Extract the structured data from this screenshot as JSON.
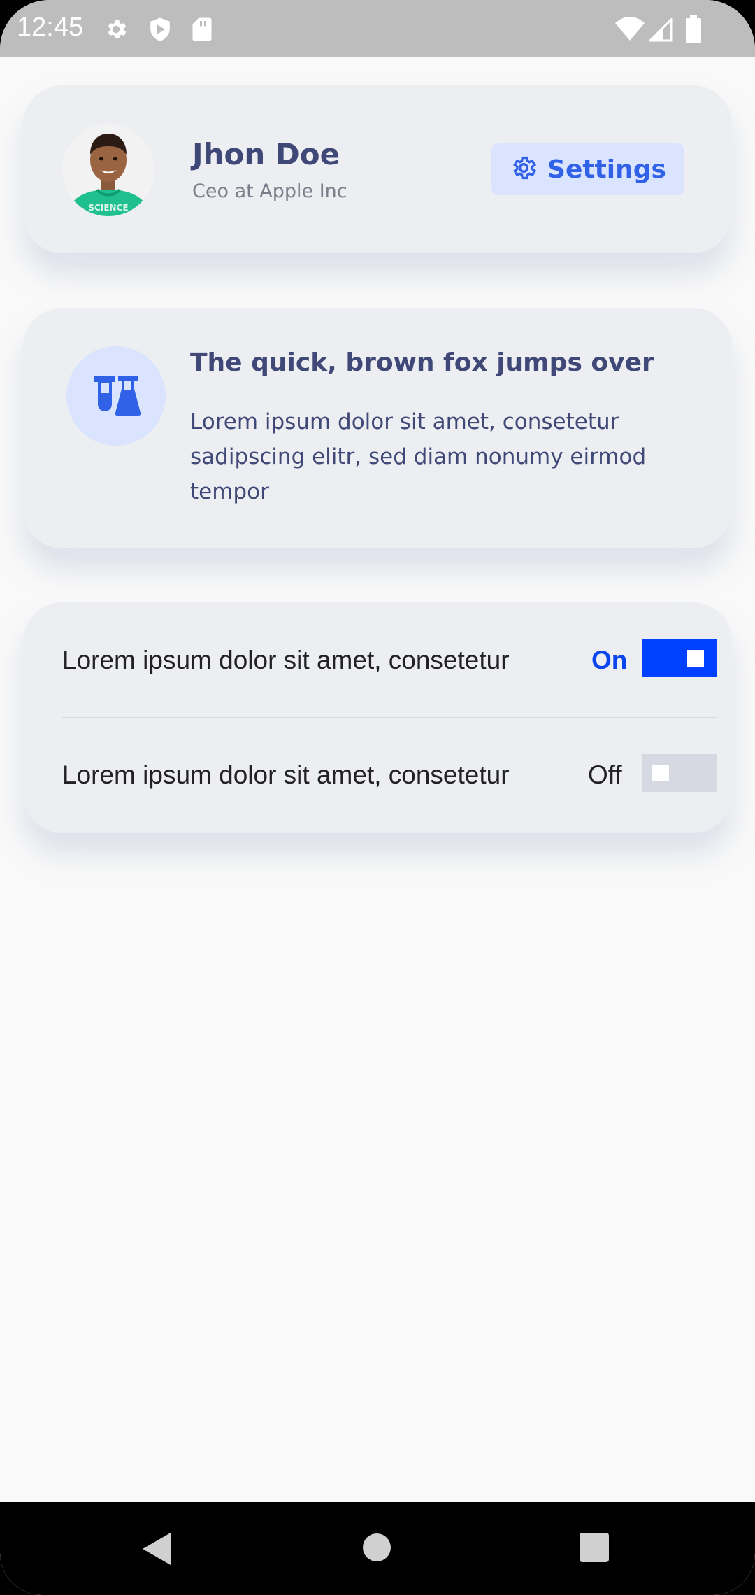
{
  "status_bar": {
    "time": "12:45",
    "icons": [
      "gear-icon",
      "shield-icon",
      "sd-card-icon",
      "wifi-icon",
      "signal-icon",
      "battery-icon"
    ]
  },
  "profile": {
    "name": "Jhon Doe",
    "role": "Ceo at Apple Inc",
    "settings_label": "Settings"
  },
  "info_card": {
    "icon": "flask-icon",
    "title": "The quick, brown fox jumps over",
    "body": "Lorem ipsum dolor sit amet, consetetur sadipscing elitr, sed diam nonumy eirmod tempor"
  },
  "toggles": [
    {
      "label": "Lorem ipsum dolor sit amet, consetetur",
      "state": "On",
      "checked": true
    },
    {
      "label": "Lorem ipsum dolor sit amet, consetetur",
      "state": "Off",
      "checked": false
    }
  ],
  "nav_bar": {
    "icons": [
      "back-icon",
      "home-icon",
      "recents-icon"
    ]
  },
  "colors": {
    "accent": "#0040ff",
    "heading": "#3f4877",
    "chip_bg": "#dbe4ff",
    "card_bg": "#eceef2"
  }
}
